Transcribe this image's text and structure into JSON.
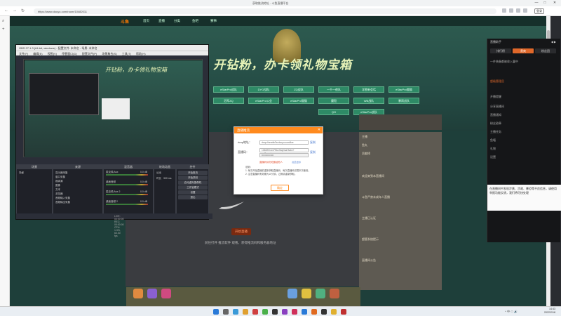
{
  "browser": {
    "tab_title": "获取推流地址 - 斗鱼直播平台",
    "url": "https://www.douyu.com/room/10482011",
    "back_glyph": "←",
    "forward_glyph": "→",
    "reload_glyph": "↻",
    "login_label": "登录",
    "minimize_glyph": "—",
    "maximize_glyph": "□",
    "close_glyph": "✕",
    "sidebar_icons": [
      "search-icon",
      "plus-icon"
    ]
  },
  "site": {
    "logo": "斗鱼",
    "nav": [
      "首页",
      "直播",
      "分类",
      "鱼吧",
      "赛事"
    ],
    "banner": "开钻粉，办卡领礼物宝箱",
    "grid_buttons": [
      "eStarPro战队",
      "DYG战队",
      "ZQ战队",
      "一千一夜队",
      "洋葱新会话",
      "eStarPro猫猫",
      "冠军ZQ",
      "eStarPro公会",
      "eStarPro猫猫",
      "魔铠",
      "WB战队",
      "暴雨战队",
      "QG",
      "eStarPro战队"
    ],
    "orange_button": "开始直播",
    "bottom_hint": "前往打开 推流软件 观看，获得推流码和服务器地址",
    "chat_rows": [
      "主播",
      "鱼丸",
      "贡献榜",
      "欢迎来到本直播间",
      "斗鱼严禁未成年人直播",
      "主播已认证",
      "超管系统提示",
      "直播间公告"
    ]
  },
  "obs": {
    "title": "OBS 27.1.3 (64-bit, windows) - 配置文件: 未命名 - 场景: 未命名",
    "menu": [
      "文件(F)",
      "编辑(E)",
      "视图(V)",
      "停靠窗口(D)",
      "配置文件(P)",
      "场景集合(S)",
      "工具(T)",
      "帮助(H)"
    ],
    "preview_banner": "开钻粉，办卡领礼物宝箱",
    "docks": {
      "scenes": {
        "title": "场景",
        "items": [
          "场景"
        ]
      },
      "sources": {
        "title": "来源",
        "items": [
          "显示器采集",
          "窗口采集",
          "媒体源",
          "图像",
          "文本",
          "浏览器",
          "音频输入采集",
          "音频输出采集"
        ]
      },
      "mixer": {
        "title": "混音器",
        "items": [
          "麦克风/Aux",
          "桌面音频",
          "麦克风/Aux 2",
          "桌面音频 2"
        ],
        "db": [
          "0.0 dB",
          "0.0 dB",
          "0.0 dB",
          "0.0 dB"
        ]
      },
      "transitions": {
        "title": "转场动画",
        "fade": "淡出",
        "duration_label": "时长",
        "duration": "300 ms"
      },
      "controls": {
        "title": "控件",
        "buttons": [
          "开始推流",
          "开始录制",
          "启动虚拟摄像机",
          "工作室模式",
          "设置",
          "退出"
        ]
      }
    },
    "status": "LIVE: 00:00:00   REC: 00:00:00   CPU: 1.3%, 60.00 fps"
  },
  "right_panel": {
    "header_left": "直播助手",
    "header_right": "◀ ▶",
    "tabs": [
      "排行榜",
      "贵宾",
      "粉丝团"
    ],
    "rows": [
      "一件装备都被收入囊中",
      "超级管理员",
      "开播提醒",
      "分享直播间",
      "直播通知",
      "粉丝勋章",
      "主播任务",
      "鱼塘",
      "礼物",
      "设置"
    ],
    "white_text": "在直播间中发现涉黄、涉政、暴恐等不良信息，请使用举报功能反馈，我们将尽快处理"
  },
  "modal": {
    "title": "直播推流",
    "close_glyph": "✕",
    "rtmp_label": "rtmp地址：",
    "rtmp_value": "rtmp://sendtc3a.douyu.com/live",
    "stream_label": "直播码：",
    "stream_value": "10482011rnPbkzXkqDsaHwbz?wsSecret=••••",
    "stream_sub": "•••••••••••••••",
    "copy_label": "复制",
    "warn": "直播码请勿泄露给他人",
    "show_link": "点此显示",
    "notes": [
      "说明：",
      "1. 每次开始直播前重新获取直播码，每次直播码仅限本次使用。",
      "2. 注意直播码有效期为10分钟，过期请重新获取。"
    ],
    "ok": "确定"
  },
  "taskbar": {
    "time": "14:43",
    "date": "2022/2/18",
    "tray": "^ 中 ☁ 🔊"
  }
}
